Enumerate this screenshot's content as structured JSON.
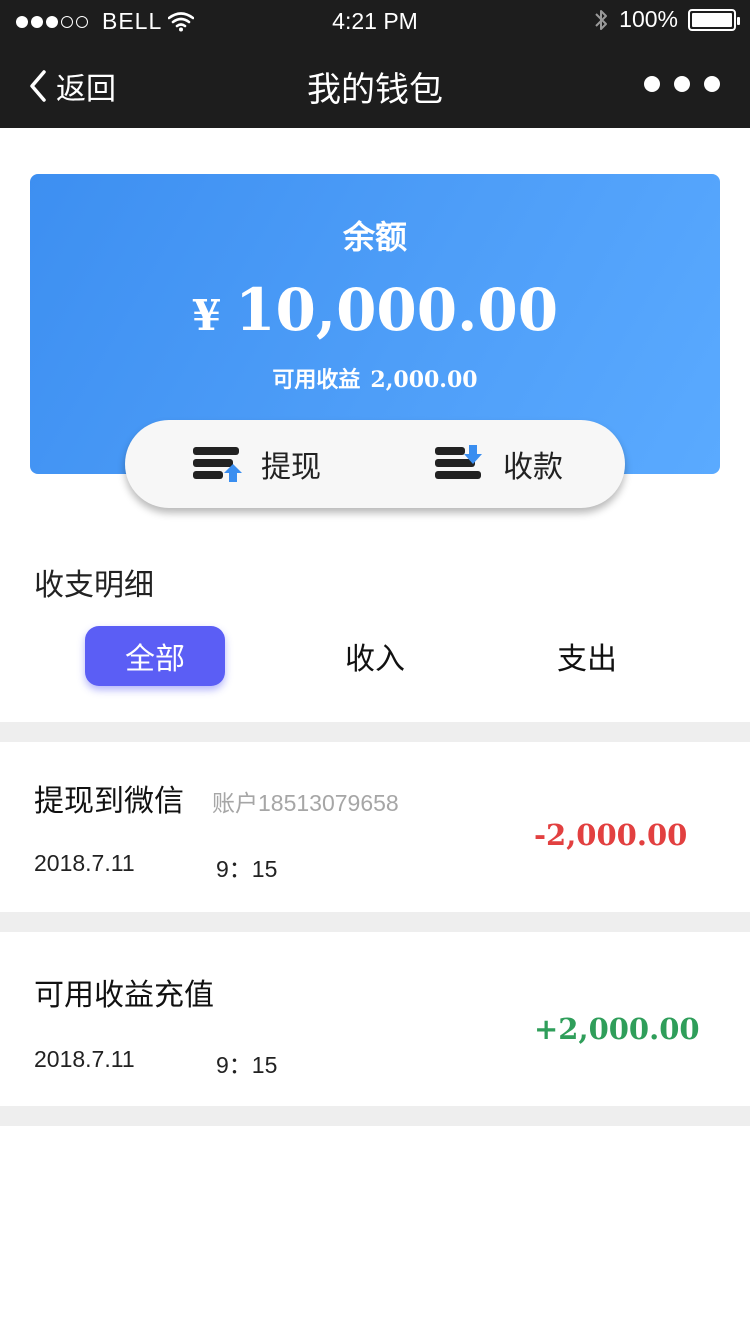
{
  "status_bar": {
    "carrier": "BELL",
    "time": "4:21 PM",
    "battery": "100%",
    "signal_level": 3
  },
  "nav": {
    "back_label": "返回",
    "title": "我的钱包"
  },
  "balance": {
    "label": "余额",
    "currency": "¥",
    "amount": "10,000.00",
    "available_label": "可用收益",
    "available_amount": "2,000.00"
  },
  "actions": {
    "withdraw_label": "提现",
    "receive_label": "收款"
  },
  "details": {
    "section_title": "收支明细",
    "tabs": [
      {
        "label": "全部",
        "active": true
      },
      {
        "label": "收入",
        "active": false
      },
      {
        "label": "支出",
        "active": false
      }
    ]
  },
  "transactions": [
    {
      "title": "提现到微信",
      "account": "账户18513079658",
      "date": "2018.7.11",
      "time": "9：15",
      "amount": "-2,000.00",
      "direction": "out"
    },
    {
      "title": "可用收益充值",
      "account": "",
      "date": "2018.7.11",
      "time": "9：15",
      "amount": "+2,000.00",
      "direction": "in"
    }
  ],
  "colors": {
    "header_bg": "#1d1d1d",
    "card_gradient_start": "#3d8ff1",
    "card_gradient_end": "#5aaaff",
    "tab_active": "#5b5ef5",
    "amount_negative": "#e24040",
    "amount_positive": "#2f9e5a",
    "icon_accent": "#3a8ef0"
  },
  "icons": {
    "back": "chevron-left-icon",
    "more": "more-dots-icon",
    "wifi": "wifi-icon",
    "bluetooth": "bluetooth-icon",
    "battery": "battery-icon",
    "withdraw": "withdraw-up-icon",
    "receive": "receive-down-icon"
  }
}
